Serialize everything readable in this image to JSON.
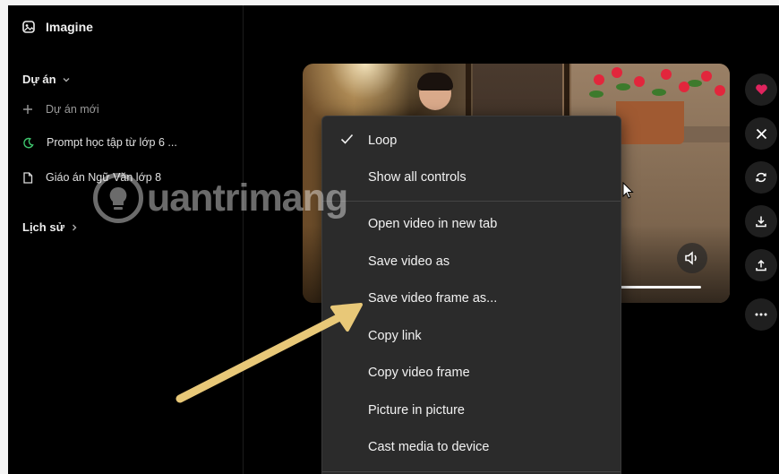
{
  "sidebar": {
    "brand": "Imagine",
    "projects_heading": "Dự án",
    "new_project": "Dự án mới",
    "items": [
      {
        "label": "Prompt học tập từ lớp 6 ...",
        "icon": "moon-icon"
      },
      {
        "label": "Giáo án Ngữ Văn lớp 8",
        "icon": "document-icon"
      }
    ],
    "history_heading": "Lịch sử"
  },
  "context_menu": {
    "items": [
      {
        "label": "Loop",
        "checked": true
      },
      {
        "label": "Show all controls"
      },
      {
        "label": "Open video in new tab"
      },
      {
        "label": "Save video as"
      },
      {
        "label": "Save video frame as..."
      },
      {
        "label": "Copy link"
      },
      {
        "label": "Copy video frame"
      },
      {
        "label": "Picture in picture"
      },
      {
        "label": "Cast media to device"
      }
    ]
  },
  "actions": [
    {
      "icon": "heart-icon"
    },
    {
      "icon": "x-logo-icon"
    },
    {
      "icon": "refresh-icon"
    },
    {
      "icon": "download-icon"
    },
    {
      "icon": "share-upload-icon"
    },
    {
      "icon": "more-icon"
    }
  ],
  "watermark": "uantrimang",
  "colors": {
    "background": "#000000",
    "menu_bg": "#2b2b2b",
    "accent_green": "#3ec46d",
    "heart_red": "#e0245e",
    "arrow": "#e8c878"
  }
}
